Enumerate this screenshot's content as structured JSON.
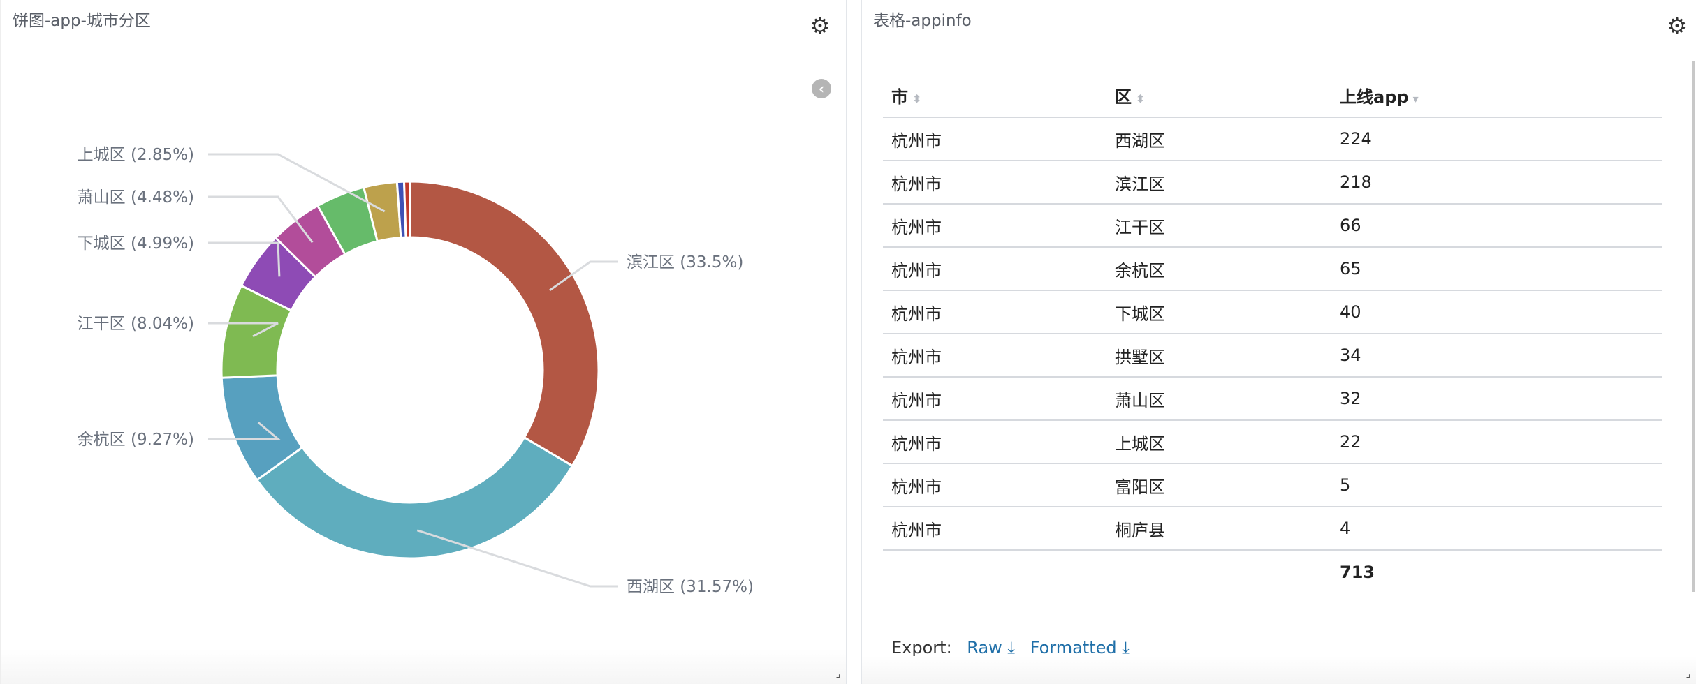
{
  "pie_panel": {
    "title": "饼图-app-城市分区",
    "gear_icon": "gear-icon",
    "collapse_icon": "chevron-left-icon"
  },
  "chart_data": {
    "type": "pie",
    "donut": true,
    "series": [
      {
        "label": "滨江区 (33.5%)",
        "value": 33.5,
        "color": "#b35744"
      },
      {
        "label": "西湖区 (31.57%)",
        "value": 31.57,
        "color": "#5fadbe"
      },
      {
        "label": "余杭区 (9.27%)",
        "value": 9.27,
        "color": "#57a0bf"
      },
      {
        "label": "江干区 (8.04%)",
        "value": 8.04,
        "color": "#7fba52"
      },
      {
        "label": "下城区 (4.99%)",
        "value": 4.99,
        "color": "#8e4bb5"
      },
      {
        "label": "萧山区 (4.48%)",
        "value": 4.48,
        "color": "#b24d9a"
      },
      {
        "label": "",
        "value": 4.2,
        "color": "#66bb6a"
      },
      {
        "label": "上城区 (2.85%)",
        "value": 2.85,
        "color": "#bda14c"
      },
      {
        "label": "",
        "value": 0.6,
        "color": "#3f51b5"
      },
      {
        "label": "",
        "value": 0.5,
        "color": "#c0392b"
      }
    ]
  },
  "table_panel": {
    "title": "表格-appinfo",
    "headers": [
      "市",
      "区",
      "上线app"
    ],
    "rows": [
      [
        "杭州市",
        "西湖区",
        "224"
      ],
      [
        "杭州市",
        "滨江区",
        "218"
      ],
      [
        "杭州市",
        "江干区",
        "66"
      ],
      [
        "杭州市",
        "余杭区",
        "65"
      ],
      [
        "杭州市",
        "下城区",
        "40"
      ],
      [
        "杭州市",
        "拱墅区",
        "34"
      ],
      [
        "杭州市",
        "萧山区",
        "32"
      ],
      [
        "杭州市",
        "上城区",
        "22"
      ],
      [
        "杭州市",
        "富阳区",
        "5"
      ],
      [
        "杭州市",
        "桐庐县",
        "4"
      ]
    ],
    "total": "713",
    "export_label": "Export:",
    "raw_label": "Raw",
    "formatted_label": "Formatted"
  }
}
